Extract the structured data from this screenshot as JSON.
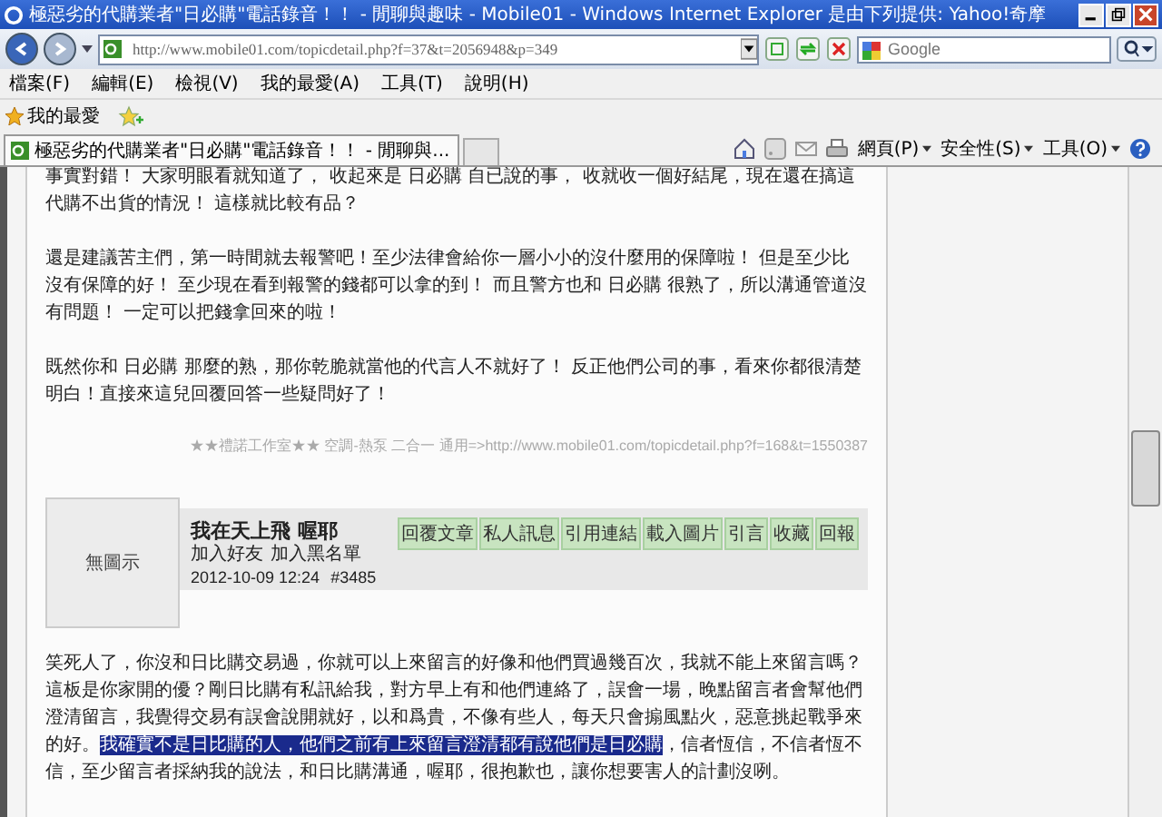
{
  "window": {
    "title": "極惡劣的代購業者\"日必購\"電話錄音！！ - 閒聊與趣味 - Mobile01 - Windows Internet Explorer 是由下列提供: Yahoo!奇摩"
  },
  "address_bar": {
    "url": "http://www.mobile01.com/topicdetail.php?f=37&t=2056948&p=349"
  },
  "search": {
    "placeholder": "Google"
  },
  "menu": [
    "檔案(F)",
    "編輯(E)",
    "檢視(V)",
    "我的最愛(A)",
    "工具(T)",
    "說明(H)"
  ],
  "favorites_bar": {
    "label": "我的最愛"
  },
  "tabs": [
    {
      "label": "極惡劣的代購業者\"日必購\"電話錄音！！ - 閒聊與...",
      "selected": true
    }
  ],
  "command_bar": [
    "網頁(P)",
    "安全性(S)",
    "工具(O)"
  ],
  "paragraphs": [
    "事實對錯！ 大家明眼看就知道了， 收起來是 日必購 自已說的事， 收就收一個好結尾，現在還在搞這代購不出貨的情況！ 這樣就比較有品？",
    "還是建議苦主們，第一時間就去報警吧！至少法律會給你一層小小的沒什麼用的保障啦！ 但是至少比沒有保障的好！ 至少現在看到報警的錢都可以拿的到！ 而且警方也和 日必購 很熟了，所以溝通管道沒有問題！ 一定可以把錢拿回來的啦！",
    "既然你和 日必購 那麼的熟，那你乾脆就當他的代言人不就好了！ 反正他們公司的事，看來你都很清楚明白！直接來這兒回覆回答一些疑問好了！"
  ],
  "signature": "★★禮諾工作室★★ 空調-熱泵 二合一 通用=>http://www.mobile01.com/topicdetail.php?f=168&t=1550387",
  "post": {
    "avatar": "無圖示",
    "author": "我在天上飛 喔耶",
    "links": [
      "加入好友",
      "加入黑名單"
    ],
    "timestamp": "2012-10-09 12:24",
    "number": "#3485",
    "buttons": [
      "回覆文章",
      "私人訊息",
      "引用連結",
      "載入圖片",
      "引言",
      "收藏",
      "回報"
    ],
    "body": [
      {
        "text": "笑死人了，你沒和日比購交易過，你就可以上來留言的好像和他們買過幾百次，我就不能上來留言嗎？這板是你家開的優？剛日比購有私訊給我，對方早上有和他們連絡了，誤會一場，晚點留言者會幫他們澄清留言，我覺得交易有誤會說開就好，以和爲貴，不像有些人，每天只會搧風點火，惡意挑起戰爭來的好。",
        "selected": false
      },
      {
        "text": "我確實不是日比購的人，他們之前有上來留言澄清都有說他們是日必購",
        "selected": true
      },
      {
        "text": "，信者恆信，不信者恆不信，至少留言者採納我的說法，和日比購溝通，喔耶，很抱歉也，讓你想要害人的計劃沒咧。",
        "selected": false
      }
    ]
  }
}
